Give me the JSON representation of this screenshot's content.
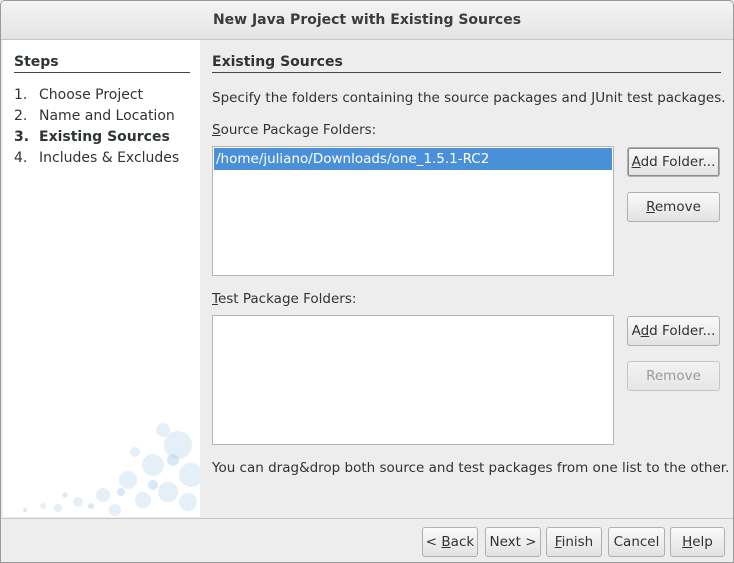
{
  "window": {
    "title": "New Java Project with Existing Sources"
  },
  "steps": {
    "heading": "Steps",
    "items": [
      {
        "num": "1.",
        "label": "Choose Project",
        "current": false
      },
      {
        "num": "2.",
        "label": "Name and Location",
        "current": false
      },
      {
        "num": "3.",
        "label": "Existing Sources",
        "current": true
      },
      {
        "num": "4.",
        "label": "Includes & Excludes",
        "current": false
      }
    ]
  },
  "panel": {
    "heading": "Existing Sources",
    "description": "Specify the folders containing the source packages and JUnit test packages.",
    "source": {
      "label_mnemonic": "S",
      "label_rest": "ource Package Folders:",
      "items": [
        "/home/juliano/Downloads/one_1.5.1-RC2"
      ],
      "add_button": {
        "mnemonic": "A",
        "rest": "dd Folder..."
      },
      "remove_button": {
        "mnemonic": "R",
        "rest": "emove",
        "enabled": true
      }
    },
    "test": {
      "label_mnemonic": "T",
      "label_rest": "est Package Folders:",
      "items": [],
      "add_button": {
        "pre": "A",
        "mnemonic": "d",
        "rest": "d Folder..."
      },
      "remove_button": {
        "label": "Remove",
        "enabled": false
      }
    },
    "hint": "You can drag&drop both source and test packages from one list to the other."
  },
  "footer": {
    "back": {
      "pre": "< ",
      "mnemonic": "B",
      "rest": "ack"
    },
    "next": {
      "label": "Next >"
    },
    "finish": {
      "mnemonic": "F",
      "rest": "inish"
    },
    "cancel": {
      "label": "Cancel"
    },
    "help": {
      "mnemonic": "H",
      "rest": "elp"
    }
  }
}
